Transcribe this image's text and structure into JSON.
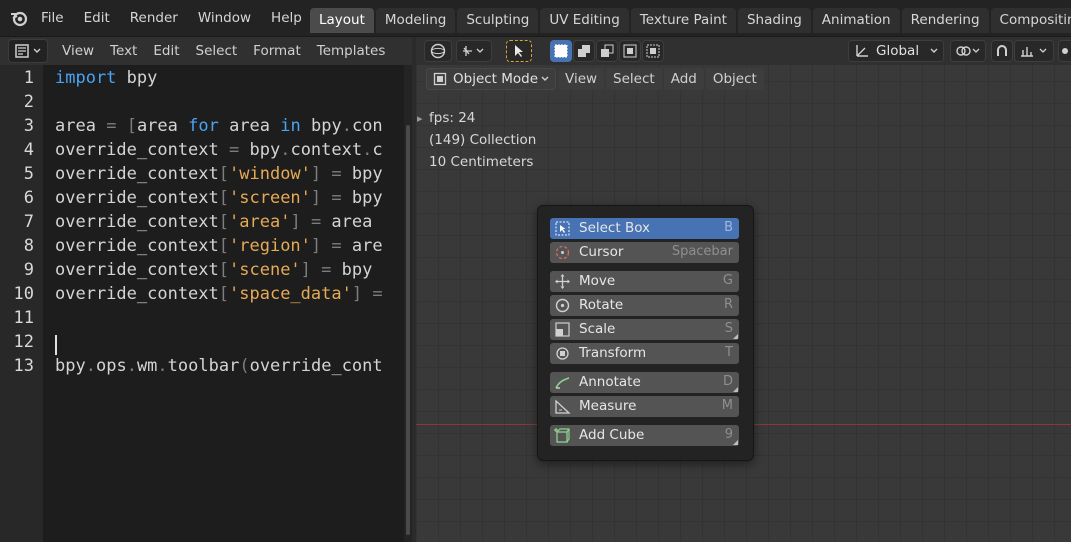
{
  "topbar": {
    "menus": [
      "File",
      "Edit",
      "Render",
      "Window",
      "Help"
    ],
    "workspaces": [
      {
        "label": "Layout",
        "active": true
      },
      {
        "label": "Modeling",
        "active": false
      },
      {
        "label": "Sculpting",
        "active": false
      },
      {
        "label": "UV Editing",
        "active": false
      },
      {
        "label": "Texture Paint",
        "active": false
      },
      {
        "label": "Shading",
        "active": false
      },
      {
        "label": "Animation",
        "active": false
      },
      {
        "label": "Rendering",
        "active": false
      },
      {
        "label": "Compositing",
        "active": false
      }
    ]
  },
  "text_editor": {
    "menus": [
      "View",
      "Text",
      "Edit",
      "Select",
      "Format",
      "Templates"
    ],
    "lines": [
      {
        "n": "1",
        "html": "<span class=\"kw\">import</span> bpy"
      },
      {
        "n": "2",
        "html": ""
      },
      {
        "n": "3",
        "html": "area <span class=\"op\">=</span> <span class=\"op\">[</span>area <span class=\"kw\">for</span> area <span class=\"kw\">in</span> bpy<span class=\"op\">.</span>con"
      },
      {
        "n": "4",
        "html": "override_context <span class=\"op\">=</span> bpy<span class=\"op\">.</span>context<span class=\"op\">.</span>c"
      },
      {
        "n": "5",
        "html": "override_context<span class=\"op\">[</span><span class=\"str\">'window'</span><span class=\"op\">]</span> <span class=\"op\">=</span> bpy"
      },
      {
        "n": "6",
        "html": "override_context<span class=\"op\">[</span><span class=\"str\">'screen'</span><span class=\"op\">]</span> <span class=\"op\">=</span> bpy"
      },
      {
        "n": "7",
        "html": "override_context<span class=\"op\">[</span><span class=\"str\">'area'</span><span class=\"op\">]</span> <span class=\"op\">=</span> area"
      },
      {
        "n": "8",
        "html": "override_context<span class=\"op\">[</span><span class=\"str\">'region'</span><span class=\"op\">]</span> <span class=\"op\">=</span> are"
      },
      {
        "n": "9",
        "html": "override_context<span class=\"op\">[</span><span class=\"str\">'scene'</span><span class=\"op\">]</span> <span class=\"op\">=</span> bpy"
      },
      {
        "n": "10",
        "html": "override_context<span class=\"op\">[</span><span class=\"str\">'space_data'</span><span class=\"op\">]</span> <span class=\"op\">=</span>"
      },
      {
        "n": "11",
        "html": ""
      },
      {
        "n": "12",
        "html": ""
      },
      {
        "n": "13",
        "html": "bpy<span class=\"op\">.</span>ops<span class=\"op\">.</span>wm<span class=\"op\">.</span>toolbar<span class=\"op\">(</span>override_cont"
      }
    ]
  },
  "viewport": {
    "mode": "Object Mode",
    "menus": [
      "View",
      "Select",
      "Add",
      "Object"
    ],
    "orientation": "Global",
    "overlay": {
      "fps": "fps: 24",
      "collection": "(149) Collection",
      "scale": "10 Centimeters"
    }
  },
  "toolbar_popup": {
    "groups": [
      [
        {
          "label": "Select Box",
          "key": "B",
          "icon": "select-box-icon",
          "active": true,
          "more": false
        },
        {
          "label": "Cursor",
          "key": "Spacebar",
          "icon": "cursor-icon",
          "active": false,
          "more": false
        }
      ],
      [
        {
          "label": "Move",
          "key": "G",
          "icon": "move-icon",
          "active": false,
          "more": false
        },
        {
          "label": "Rotate",
          "key": "R",
          "icon": "rotate-icon",
          "active": false,
          "more": false
        },
        {
          "label": "Scale",
          "key": "S",
          "icon": "scale-icon",
          "active": false,
          "more": true
        },
        {
          "label": "Transform",
          "key": "T",
          "icon": "transform-icon",
          "active": false,
          "more": false
        }
      ],
      [
        {
          "label": "Annotate",
          "key": "D",
          "icon": "annotate-icon",
          "active": false,
          "more": true
        },
        {
          "label": "Measure",
          "key": "M",
          "icon": "measure-icon",
          "active": false,
          "more": false
        }
      ],
      [
        {
          "label": "Add Cube",
          "key": "9",
          "icon": "add-cube-icon",
          "active": false,
          "more": true
        }
      ]
    ]
  },
  "colors": {
    "accent_blue": "#4772b3",
    "keyword": "#4aa3f0",
    "string": "#e6a955",
    "x_axis": "#8c3838"
  }
}
